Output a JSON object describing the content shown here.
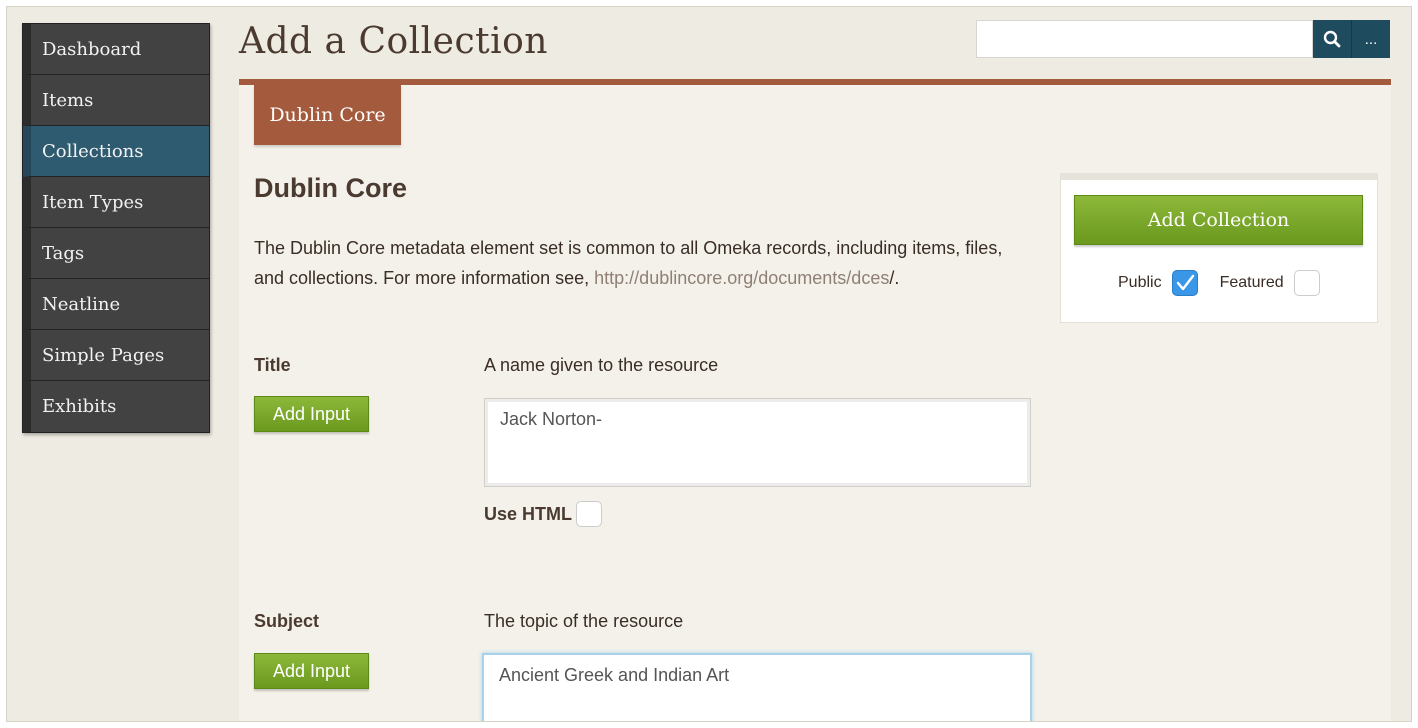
{
  "sidebar": {
    "items": [
      {
        "label": "Dashboard"
      },
      {
        "label": "Items"
      },
      {
        "label": "Collections"
      },
      {
        "label": "Item Types"
      },
      {
        "label": "Tags"
      },
      {
        "label": "Neatline"
      },
      {
        "label": "Simple Pages"
      },
      {
        "label": "Exhibits"
      }
    ],
    "active": "Collections"
  },
  "header": {
    "title": "Add a Collection",
    "search": {
      "value": "",
      "more_label": "..."
    }
  },
  "tabs": [
    {
      "label": "Dublin Core",
      "active": true
    }
  ],
  "section": {
    "title": "Dublin Core",
    "desc_prefix": "The Dublin Core metadata element set is common to all Omeka records, including items, files, and collections. For more information see, ",
    "desc_link": "http://dublincore.org/documents/dces",
    "desc_suffix": "/."
  },
  "fields": {
    "title": {
      "label": "Title",
      "description": "A name given to the resource",
      "add_input_label": "Add Input",
      "value": "Jack Norton-",
      "use_html_label": "Use HTML",
      "use_html_checked": false
    },
    "subject": {
      "label": "Subject",
      "description": "The topic of the resource",
      "add_input_label": "Add Input",
      "value": "Ancient Greek and Indian Art"
    }
  },
  "save_panel": {
    "button_label": "Add Collection",
    "public_label": "Public",
    "public_checked": true,
    "featured_label": "Featured",
    "featured_checked": false
  },
  "colors": {
    "nav_active": "#2f5b70",
    "accent": "#a45a3d",
    "button_green": "#7aa82a",
    "search_btn": "#1f4b5e"
  }
}
